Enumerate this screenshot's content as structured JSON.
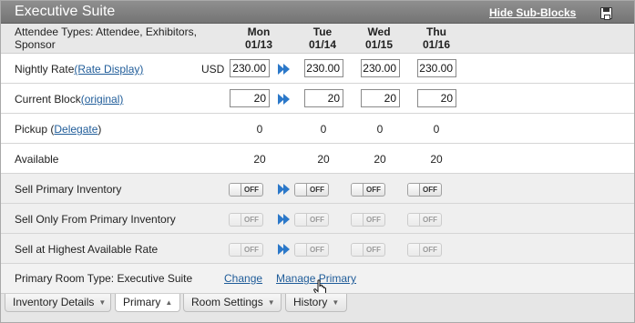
{
  "panel": {
    "title": "Executive Suite",
    "hide_link": "Hide Sub-Blocks",
    "save_icon": "save-disk-icon"
  },
  "header": {
    "attendee_line1": "Attendee Types: Attendee, Exhibitors,",
    "attendee_line2": "Sponsor",
    "days": [
      {
        "dow": "Mon",
        "date": "01/13"
      },
      {
        "dow": "Tue",
        "date": "01/14"
      },
      {
        "dow": "Wed",
        "date": "01/15"
      },
      {
        "dow": "Thu",
        "date": "01/16"
      }
    ]
  },
  "rows": {
    "nightly_rate": {
      "label": "Nightly Rate",
      "link": "(Rate Display)",
      "currency": "USD",
      "values": [
        "230.00",
        "230.00",
        "230.00",
        "230.00"
      ]
    },
    "current_block": {
      "label": "Current Block",
      "link": "(original)",
      "values": [
        "20",
        "20",
        "20",
        "20"
      ]
    },
    "pickup": {
      "label_pre": "Pickup (",
      "link": "Delegate",
      "label_post": ")",
      "values": [
        "0",
        "0",
        "0",
        "0"
      ]
    },
    "available": {
      "label": "Available",
      "values": [
        "20",
        "20",
        "20",
        "20"
      ]
    },
    "sell_primary": {
      "label": "Sell Primary Inventory",
      "toggle_text": "OFF"
    },
    "sell_only_primary": {
      "label": "Sell Only From Primary Inventory",
      "toggle_text": "OFF"
    },
    "sell_highest": {
      "label": "Sell at Highest Available Rate",
      "toggle_text": "OFF"
    }
  },
  "footer": {
    "primary_room_type": "Primary Room Type: Executive Suite",
    "change": "Change",
    "manage_primary": "Manage Primary"
  },
  "tabs": [
    {
      "label": "Inventory Details",
      "caret": "▼"
    },
    {
      "label": "Primary",
      "caret": "▲"
    },
    {
      "label": "Room Settings",
      "caret": "▼"
    },
    {
      "label": "History",
      "caret": "▼"
    }
  ],
  "colors": {
    "title_bar": "#7f7f7f",
    "link": "#1f5c99",
    "copy_arrow": "#2b78c9"
  }
}
